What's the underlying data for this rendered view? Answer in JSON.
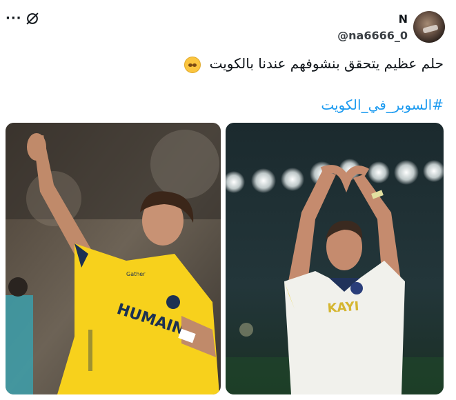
{
  "post": {
    "author": {
      "display_name": "N",
      "handle": "@na6666_0"
    },
    "text": "حلم عظيم يتحقق بنشوفهم عندنا بالكويت",
    "emoji": "pleading-face-emoji",
    "hashtag": "#السوبر_في_الكويت",
    "actions": {
      "more_label": "···"
    },
    "media": [
      {
        "description_icon": "photo",
        "jersey_text": "HUMAIN",
        "sponsor": "Gather",
        "jersey_color": "#f7d11c"
      },
      {
        "description_icon": "photo",
        "jersey_text": "KAYI",
        "jersey_color": "#f1f1ec"
      }
    ]
  },
  "colors": {
    "text": "#0f1419",
    "link": "#1d9bf0",
    "background": "#ffffff"
  }
}
